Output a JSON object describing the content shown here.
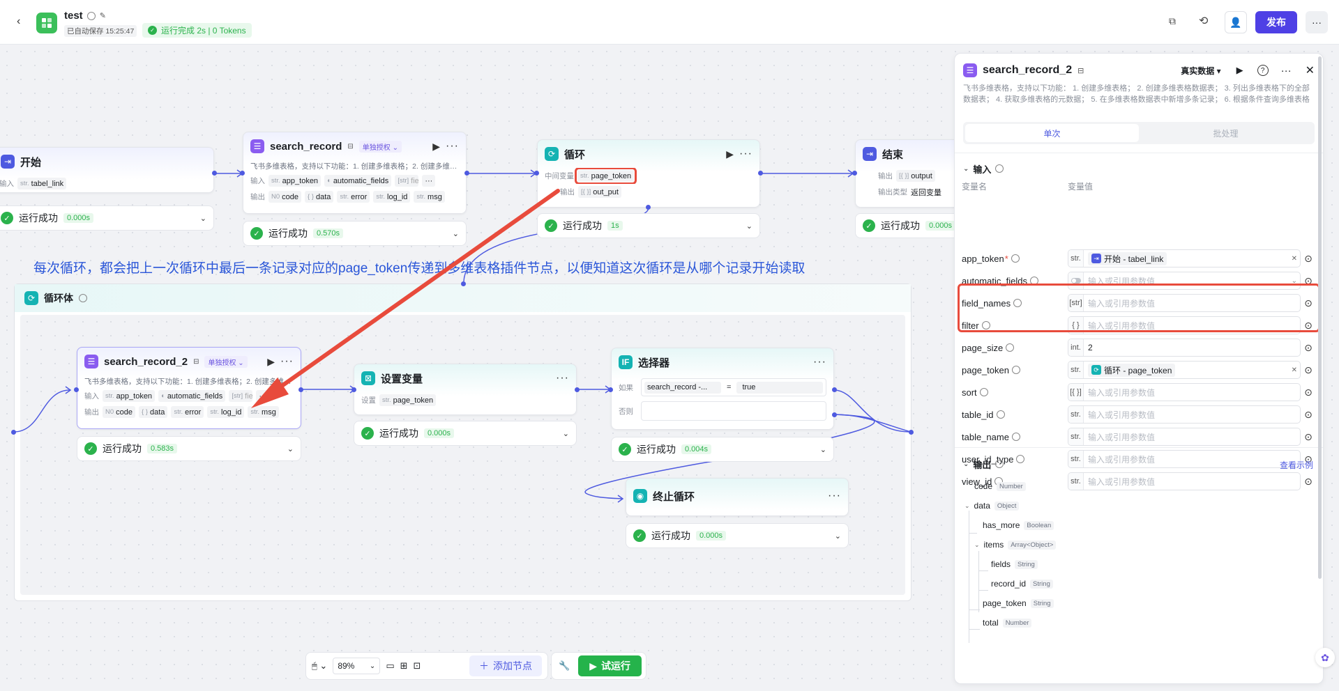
{
  "header": {
    "title": "test",
    "autosave": "已自动保存 15:25:47",
    "run_status": "运行完成 2s | 0 Tokens",
    "publish_label": "发布"
  },
  "colors": {
    "accent": "#4e5ae0",
    "success": "#2bb24c",
    "annotation_red": "#e84b3c",
    "annotation_text": "#2a56d8"
  },
  "nodes": {
    "start": {
      "title": "开始",
      "row_label": "输入",
      "chip_type": "str.",
      "chip": "tabel_link",
      "run": "运行成功",
      "time": "0.000s"
    },
    "search_record": {
      "title": "search_record",
      "auth": "单独授权",
      "desc": "飞书多维表格，支持以下功能：1. 创建多维表格；2. 创建多维表格数据表；",
      "in_label": "输入",
      "in1_t": "str.",
      "in1": "app_token",
      "in2": "automatic_fields",
      "in3_t": "[str]",
      "in3": "field",
      "out_label": "输出",
      "o1_t": "N0",
      "o1": "code",
      "o2_t": "{ }",
      "o2": "data",
      "o3_t": "str.",
      "o3": "error",
      "o4_t": "str.",
      "o4": "log_id",
      "o5_t": "str.",
      "o5": "msg",
      "run": "运行成功",
      "time": "0.570s"
    },
    "loop": {
      "title": "循环",
      "mid_label": "中间变量",
      "mid_t": "str.",
      "mid": "page_token",
      "out_label": "输出",
      "out_t": "[{ }]",
      "out": "out_put",
      "run": "运行成功",
      "time": "1s"
    },
    "end": {
      "title": "结束",
      "out_label": "输出",
      "out_t": "[{ }]",
      "out": "output",
      "type_label": "输出类型",
      "type_val": "返回变量",
      "run": "运行成功",
      "time": "0.000s"
    },
    "loop_body": {
      "title": "循环体"
    },
    "search_record_2": {
      "title": "search_record_2",
      "auth": "单独授权",
      "desc": "飞书多维表格，支持以下功能：1. 创建多维表格；2. 创建多维表格数据表；",
      "in_label": "输入",
      "in1_t": "str.",
      "in1": "app_token",
      "in2": "automatic_fields",
      "in3_t": "[str]",
      "in3": "field",
      "out_label": "输出",
      "o1_t": "N0",
      "o1": "code",
      "o2_t": "{ }",
      "o2": "data",
      "o3_t": "str.",
      "o3": "error",
      "o4_t": "str.",
      "o4": "log_id",
      "o5_t": "str.",
      "o5": "msg",
      "run": "运行成功",
      "time": "0.583s"
    },
    "set_var": {
      "title": "设置变量",
      "label": "设置",
      "chip_t": "str.",
      "chip": "page_token",
      "run": "运行成功",
      "time": "0.000s"
    },
    "selector": {
      "title": "选择器",
      "if_label": "如果",
      "cond_left": "search_record -...",
      "cond_op": "=",
      "cond_right": "true",
      "else_label": "否则",
      "run": "运行成功",
      "time": "0.004s"
    },
    "stop_loop": {
      "title": "终止循环",
      "run": "运行成功",
      "time": "0.000s"
    }
  },
  "annotation": {
    "text": "每次循环，都会把上一次循环中最后一条记录对应的page_token传递到多维表格插件节点，以便知道这次循环是从哪个记录开始读取"
  },
  "toolbar": {
    "zoom": "89%",
    "add_node": "添加节点",
    "trial_run": "试运行"
  },
  "panel": {
    "title": "search_record_2",
    "data_mode": "真实数据",
    "desc": "飞书多维表格，支持以下功能： 1. 创建多维表格； 2. 创建多维表格数据表； 3. 列出多维表格下的全部数据表； 4. 获取多维表格的元数据； 5. 在多维表格数据表中新增多条记录； 6. 根据条件查询多维表格记录；",
    "tab_single": "单次",
    "tab_batch": "批处理",
    "input_section": "输入",
    "col_name": "变量名",
    "col_value": "变量值",
    "params": [
      {
        "name": "app_token",
        "required": "*",
        "type": "str.",
        "value": "开始 - tabel_link",
        "ref": "start",
        "placeholder": ""
      },
      {
        "name": "automatic_fields",
        "required": "",
        "type": "toggle",
        "value": "",
        "ref": "",
        "placeholder": "输入或引用参数值"
      },
      {
        "name": "field_names",
        "required": "",
        "type": "[str]",
        "value": "",
        "ref": "",
        "placeholder": "输入或引用参数值"
      },
      {
        "name": "filter",
        "required": "",
        "type": "{ }",
        "value": "",
        "ref": "",
        "placeholder": "输入或引用参数值"
      },
      {
        "name": "page_size",
        "required": "",
        "type": "int.",
        "value": "2",
        "ref": "",
        "placeholder": ""
      },
      {
        "name": "page_token",
        "required": "",
        "type": "str.",
        "value": "循环 - page_token",
        "ref": "loop",
        "placeholder": ""
      },
      {
        "name": "sort",
        "required": "",
        "type": "[{ }]",
        "value": "",
        "ref": "",
        "placeholder": "输入或引用参数值"
      },
      {
        "name": "table_id",
        "required": "",
        "type": "str.",
        "value": "",
        "ref": "",
        "placeholder": "输入或引用参数值"
      },
      {
        "name": "table_name",
        "required": "",
        "type": "str.",
        "value": "",
        "ref": "",
        "placeholder": "输入或引用参数值"
      },
      {
        "name": "user_id_type",
        "required": "",
        "type": "str.",
        "value": "",
        "ref": "",
        "placeholder": "输入或引用参数值"
      },
      {
        "name": "view_id",
        "required": "",
        "type": "str.",
        "value": "",
        "ref": "",
        "placeholder": "输入或引用参数值"
      }
    ],
    "output_section": "输出",
    "view_example": "查看示例",
    "outputs": [
      {
        "name": "code",
        "type": "Number"
      },
      {
        "name": "data",
        "type": "Object"
      },
      {
        "name": "has_more",
        "type": "Boolean"
      },
      {
        "name": "items",
        "type": "Array<Object>"
      },
      {
        "name": "fields",
        "type": "String"
      },
      {
        "name": "record_id",
        "type": "String"
      },
      {
        "name": "page_token",
        "type": "String"
      },
      {
        "name": "total",
        "type": "Number"
      }
    ]
  }
}
